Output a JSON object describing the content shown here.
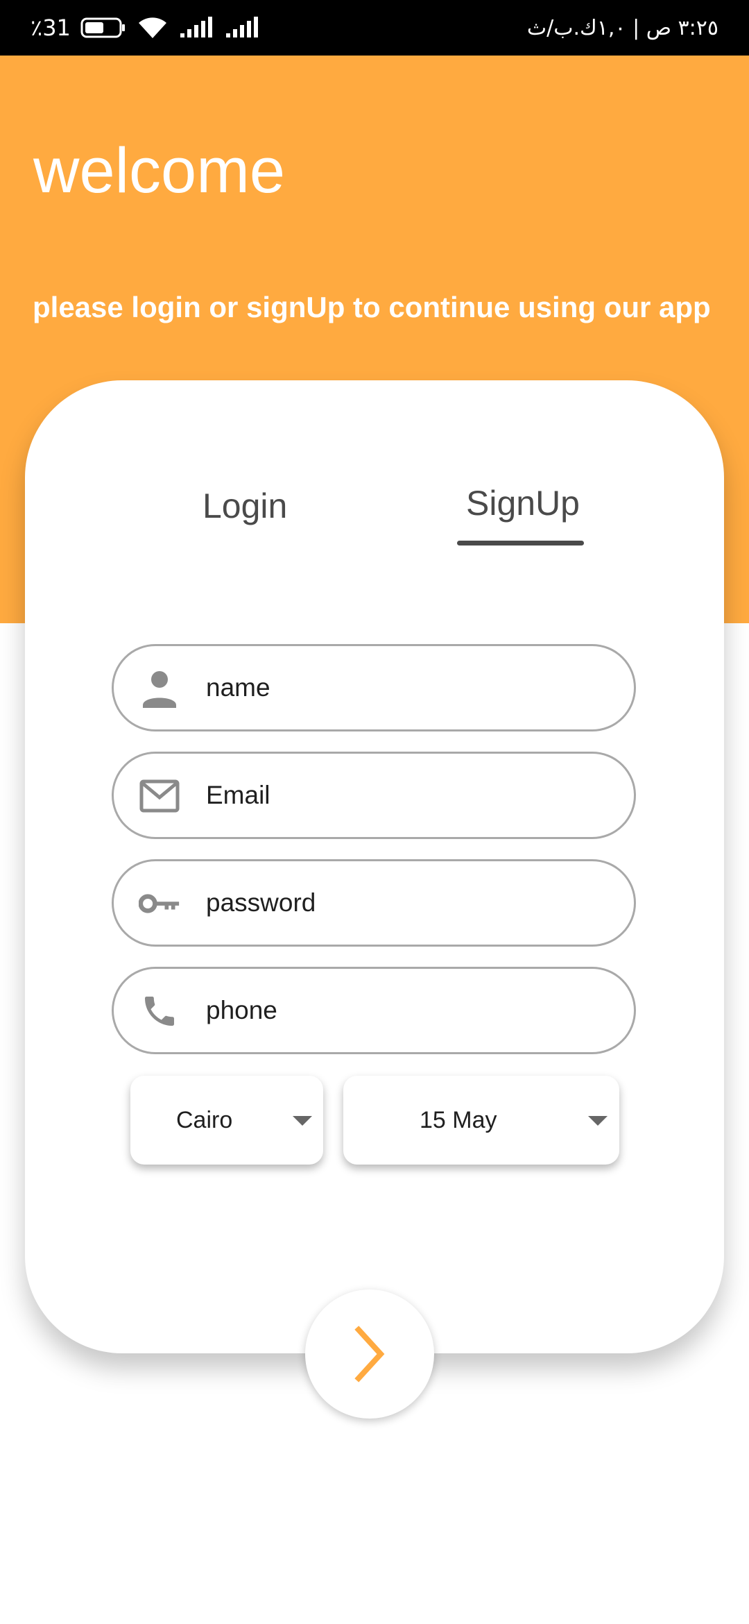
{
  "status_bar": {
    "battery_percent": "٪31",
    "time_and_date": "٣:٢٥ ص | ١,٠ك.ب/ث"
  },
  "header": {
    "title": "welcome",
    "subtitle": "please login or signUp to continue using our app"
  },
  "tabs": {
    "login_label": "Login",
    "signup_label": "SignUp",
    "active": "SignUp"
  },
  "form": {
    "name_placeholder": "name",
    "email_placeholder": "Email",
    "password_placeholder": "password",
    "phone_placeholder": "phone",
    "city_value": "Cairo",
    "date_value": "15 May"
  },
  "colors": {
    "accent": "#FFAA40",
    "tab_text": "#4a4a4a",
    "field_border": "#a9a9a9",
    "icon_gray": "#8a8a8a"
  },
  "icons": {
    "name": "person-icon",
    "email": "mail-icon",
    "password": "key-icon",
    "phone": "phone-icon",
    "dropdown": "caret-down-icon",
    "next": "chevron-right-icon"
  }
}
